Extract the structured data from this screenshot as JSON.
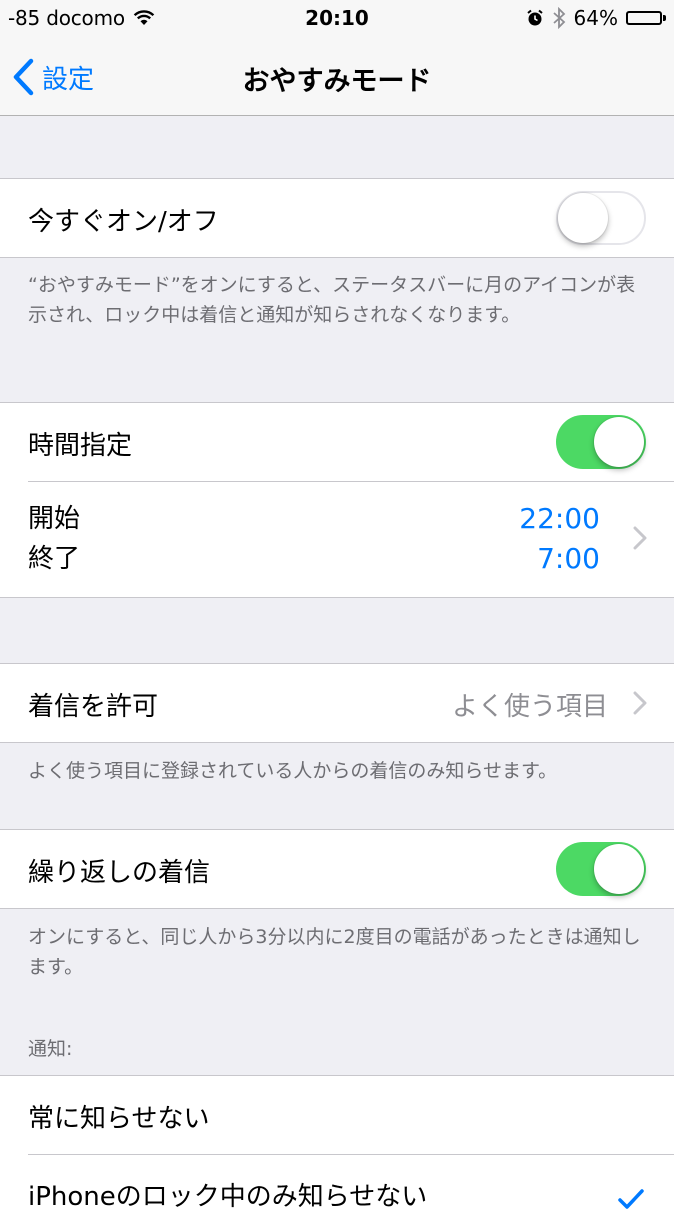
{
  "status_bar": {
    "carrier": "-85 docomo",
    "time": "20:10",
    "battery": "64%",
    "battery_level": 0.64,
    "icons": [
      "wifi-icon",
      "alarm-icon",
      "bluetooth-icon",
      "battery-icon"
    ]
  },
  "nav": {
    "back_label": "設定",
    "title": "おやすみモード"
  },
  "manual": {
    "label": "今すぐオン/オフ",
    "toggle_on": false,
    "footer": "“おやすみモード”をオンにすると、ステータスバーに月のアイコンが表示され、ロック中は着信と通知が知らされなくなります。"
  },
  "scheduled": {
    "label": "時間指定",
    "toggle_on": true,
    "start_label": "開始",
    "end_label": "終了",
    "start_time": "22:00",
    "end_time": "7:00"
  },
  "allow_calls": {
    "label": "着信を許可",
    "value": "よく使う項目",
    "footer": "よく使う項目に登録されている人からの着信のみ知らせます。"
  },
  "repeated_calls": {
    "label": "繰り返しの着信",
    "toggle_on": true,
    "footer": "オンにすると、同じ人から3分以内に2度目の電話があったときは通知します。"
  },
  "silence": {
    "header": "通知:",
    "options": [
      {
        "label": "常に知らせない",
        "selected": false
      },
      {
        "label": "iPhoneのロック中のみ知らせない",
        "selected": true
      }
    ]
  },
  "colors": {
    "accent": "#007aff",
    "toggle_on": "#4cd964",
    "background": "#efeff4"
  }
}
